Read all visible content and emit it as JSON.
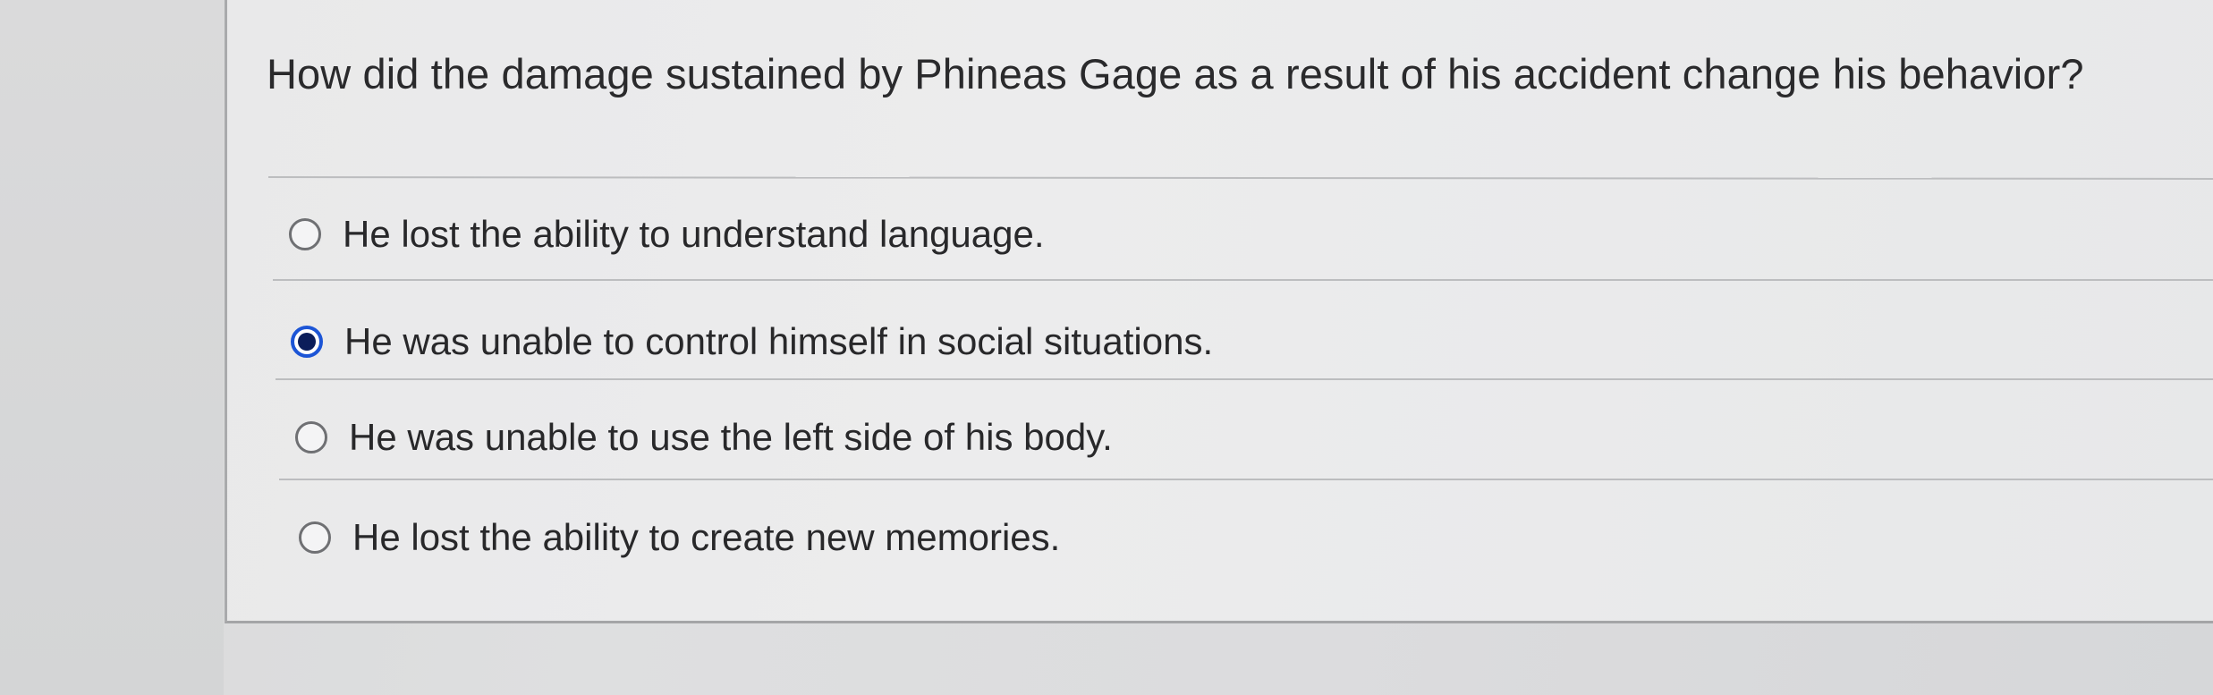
{
  "question": {
    "text": "How did the damage sustained by Phineas Gage as a result of his accident change his behavior?"
  },
  "options": [
    {
      "label": "He lost the ability to understand language.",
      "selected": false
    },
    {
      "label": "He was unable to control himself in social situations.",
      "selected": true
    },
    {
      "label": "He was unable to use the left side of his body.",
      "selected": false
    },
    {
      "label": "He lost the ability to create new memories.",
      "selected": false
    }
  ],
  "colors": {
    "selected_radio": "#1c55d6",
    "selected_dot": "#0b1d5a",
    "text": "#28282a"
  },
  "icons": {
    "radio": "radio-button-icon"
  }
}
